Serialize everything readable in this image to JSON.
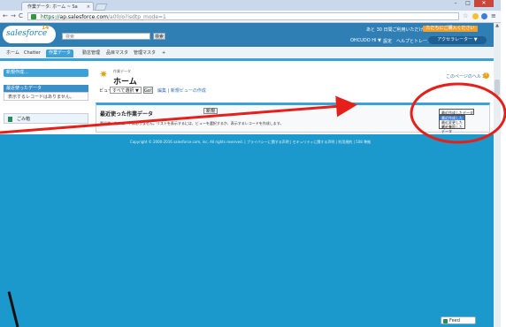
{
  "browser": {
    "tab_title": "作業データ: ホーム ~ Sa",
    "tab_close": "×",
    "win_min": "–",
    "win_max": "□",
    "win_close": "✕",
    "back": "←",
    "forward": "→",
    "reload": "C",
    "url_scheme": "https://",
    "url_host": "ap.salesforce.com",
    "url_path": "/a00/o?isdtp_mode=1",
    "star": "☆",
    "menu": "≡"
  },
  "header": {
    "logo_text": "salesforce",
    "logo_badge": "14",
    "search_placeholder": "検索",
    "search_button": "検索",
    "notice": "あと 30 日間ご利用いただけます。",
    "trial_button": "ただちにご購入ください",
    "user_menu": "OHCUDO HI ▼",
    "setup": "設定",
    "help": "ヘルプとトレーニング",
    "app_menu": "アクセラレーター ▼"
  },
  "tabs": [
    {
      "label": "ホーム",
      "active": false
    },
    {
      "label": "Chatter",
      "active": false
    },
    {
      "label": "作業データ",
      "active": true
    },
    {
      "label": "勤怠管理",
      "active": false
    },
    {
      "label": "品目マスタ",
      "active": false
    },
    {
      "label": "管理マスタ",
      "active": false
    },
    {
      "label": "+",
      "active": false
    }
  ],
  "sidebar": {
    "new_button": "新規作成…",
    "recent_header": "最近使ったデータ",
    "recent_empty": "表示するレコードはありません。",
    "trash": "ごみ箱"
  },
  "main": {
    "object_label": "作業データ",
    "page_title": "ホーム",
    "help_link": "このページのヘルプ",
    "help_icon": "?",
    "view_label": "ビュー:",
    "view_select": "すべて選択 ▼",
    "go_button": "Go!",
    "view_links": "編集 | 新規ビューの作成",
    "panel_title": "最近使った作業データ",
    "new_record_button": "新規",
    "panel_text": "最近使ったレコードはありません。リストを表示するには、ビューを選択するか、表示するレコードを作成します。",
    "recent_select": "最近作成したデータ ▼",
    "recent_options": [
      {
        "label": "最近作成したデータ",
        "selected": true
      },
      {
        "label": "最近変更したデータ",
        "selected": false
      },
      {
        "label": "最近参照したデータ",
        "selected": false
      }
    ]
  },
  "footer": {
    "text": "Copyright © 2000-2016 salesforce.com, inc. All rights reserved. | プライバシーに関する声明 | セキュリティに関する声明 | 利用規約 | 508 準拠"
  },
  "feed_button": "Feed",
  "annotation": {
    "color": "#e5201a"
  }
}
